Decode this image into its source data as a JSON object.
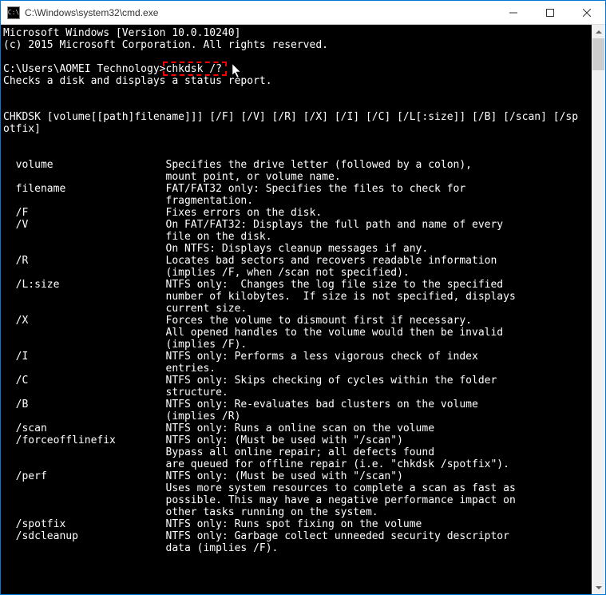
{
  "window": {
    "title": "C:\\Windows\\system32\\cmd.exe"
  },
  "header": {
    "line1": "Microsoft Windows [Version 10.0.10240]",
    "line2": "(c) 2015 Microsoft Corporation. All rights reserved."
  },
  "prompt": {
    "path": "C:\\Users\\AOMEI Technology>",
    "command": "chkdsk /?",
    "result": "Checks a disk and displays a status report."
  },
  "syntax": "CHKDSK [volume[[path]filename]]] [/F] [/V] [/R] [/X] [/I] [/C] [/L[:size]] [/B] [/scan] [/spotfix]",
  "params": [
    {
      "flag": "  volume",
      "desc": [
        "Specifies the drive letter (followed by a colon),",
        "mount point, or volume name."
      ]
    },
    {
      "flag": "  filename",
      "desc": [
        "FAT/FAT32 only: Specifies the files to check for",
        "fragmentation."
      ]
    },
    {
      "flag": "  /F",
      "desc": [
        "Fixes errors on the disk."
      ]
    },
    {
      "flag": "  /V",
      "desc": [
        "On FAT/FAT32: Displays the full path and name of every",
        "file on the disk.",
        "On NTFS: Displays cleanup messages if any."
      ]
    },
    {
      "flag": "  /R",
      "desc": [
        "Locates bad sectors and recovers readable information",
        "(implies /F, when /scan not specified)."
      ]
    },
    {
      "flag": "  /L:size",
      "desc": [
        "NTFS only:  Changes the log file size to the specified",
        "number of kilobytes.  If size is not specified, displays",
        "current size."
      ]
    },
    {
      "flag": "  /X",
      "desc": [
        "Forces the volume to dismount first if necessary.",
        "All opened handles to the volume would then be invalid",
        "(implies /F)."
      ]
    },
    {
      "flag": "  /I",
      "desc": [
        "NTFS only: Performs a less vigorous check of index",
        "entries."
      ]
    },
    {
      "flag": "  /C",
      "desc": [
        "NTFS only: Skips checking of cycles within the folder",
        "structure."
      ]
    },
    {
      "flag": "  /B",
      "desc": [
        "NTFS only: Re-evaluates bad clusters on the volume",
        "(implies /R)"
      ]
    },
    {
      "flag": "  /scan",
      "desc": [
        "NTFS only: Runs a online scan on the volume"
      ]
    },
    {
      "flag": "  /forceofflinefix",
      "desc": [
        "NTFS only: (Must be used with \"/scan\")",
        "Bypass all online repair; all defects found",
        "are queued for offline repair (i.e. \"chkdsk /spotfix\")."
      ]
    },
    {
      "flag": "  /perf",
      "desc": [
        "NTFS only: (Must be used with \"/scan\")",
        "Uses more system resources to complete a scan as fast as",
        "possible. This may have a negative performance impact on",
        "other tasks running on the system."
      ]
    },
    {
      "flag": "  /spotfix",
      "desc": [
        "NTFS only: Runs spot fixing on the volume"
      ]
    },
    {
      "flag": "  /sdcleanup",
      "desc": [
        "NTFS only: Garbage collect unneeded security descriptor",
        "data (implies /F)."
      ]
    }
  ]
}
